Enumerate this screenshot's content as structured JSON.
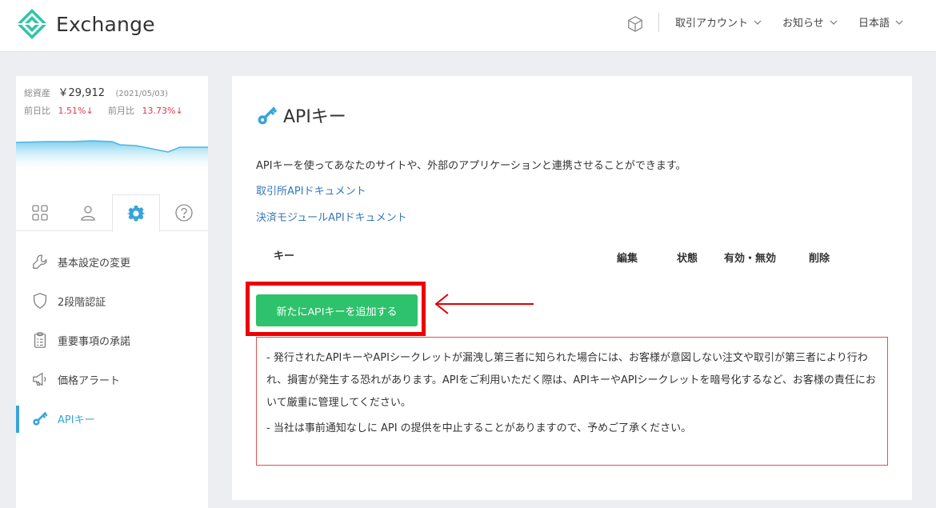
{
  "header": {
    "brand": "Exchange",
    "menus": [
      {
        "label": "取引アカウント"
      },
      {
        "label": "お知らせ"
      },
      {
        "label": "日本語"
      }
    ]
  },
  "sidebar": {
    "asset_label": "総資産",
    "asset_value": "￥29,912",
    "asset_date": "(2021/05/03)",
    "day_label": "前日比",
    "day_value": "1.51%↓",
    "month_label": "前月比",
    "month_value": "13.73%↓",
    "items": [
      {
        "label": "基本設定の変更"
      },
      {
        "label": "2段階認証"
      },
      {
        "label": "重要事項の承諾"
      },
      {
        "label": "価格アラート"
      },
      {
        "label": "APIキー"
      }
    ]
  },
  "main": {
    "title": "APIキー",
    "description": "APIキーを使ってあなたのサイトや、外部のアプリケーションと連携させることができます。",
    "links": [
      {
        "label": "取引所APIドキュメント"
      },
      {
        "label": "決済モジュールAPIドキュメント"
      }
    ],
    "columns": [
      "キー",
      "編集",
      "状態",
      "有効・無効",
      "削除"
    ],
    "add_button": "新たにAPIキーを追加する",
    "notice": [
      "- 発行されたAPIキーやAPIシークレットが漏洩し第三者に知られた場合には、お客様が意図しない注文や取引が第三者により行われ、損害が発生する恐れがあります。APIをご利用いただく際は、APIキーやAPIシークレットを暗号化するなど、お客様の責任において厳重に管理してください。",
      "- 当社は事前通知なしに API の提供を中止することがありますので、予めご了承ください。"
    ]
  },
  "colors": {
    "accent": "#3aa4d8",
    "button": "#2dc26b",
    "negative": "#e2374c",
    "highlight": "#ee0000"
  }
}
